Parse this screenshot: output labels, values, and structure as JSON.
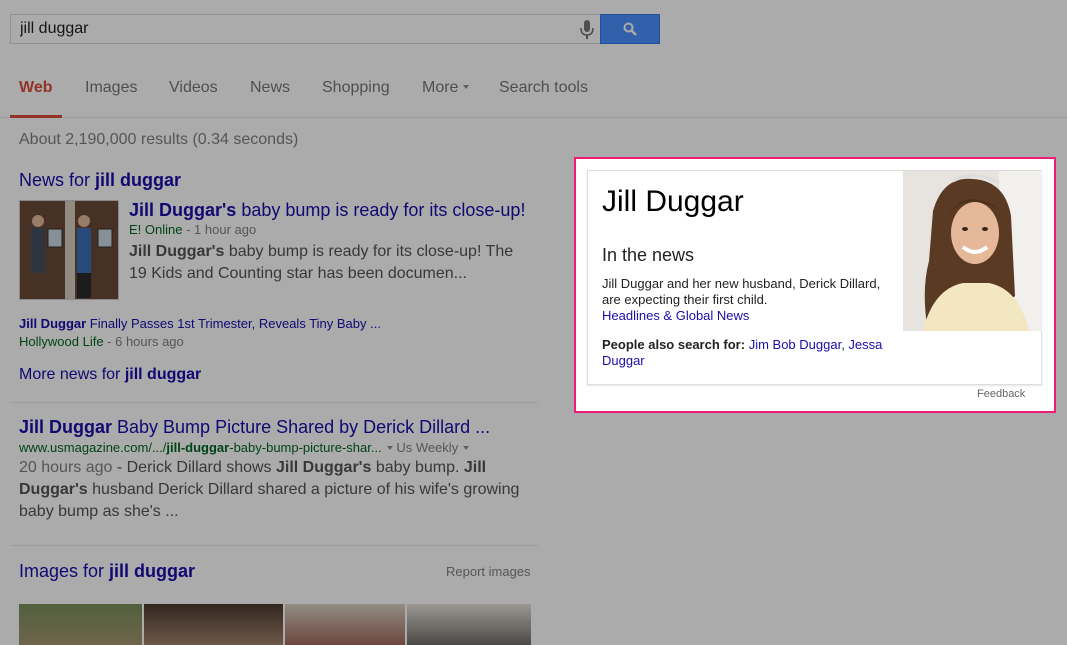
{
  "search": {
    "query": "jill duggar"
  },
  "tabs": [
    {
      "label": "Web",
      "active": true
    },
    {
      "label": "Images"
    },
    {
      "label": "Videos"
    },
    {
      "label": "News"
    },
    {
      "label": "Shopping"
    },
    {
      "label": "More"
    },
    {
      "label": "Search tools"
    }
  ],
  "stats": "About 2,190,000 results (0.34 seconds)",
  "news_block": {
    "header_prefix": "News for ",
    "header_query": "jill duggar",
    "top": {
      "title_bold": "Jill Duggar's",
      "title_rest": " baby bump is ready for its close-up!",
      "source": "E! Online",
      "time": " - 1 hour ago",
      "snippet_bold": "Jill Duggar's",
      "snippet_rest": " baby bump is ready for its close-up! The 19 Kids and Counting star has been documen..."
    },
    "second": {
      "title_bold": "Jill Duggar",
      "title_rest": " Finally Passes 1st Trimester, Reveals Tiny Baby ...",
      "source": "Hollywood Life",
      "time": " - 6 hours ago"
    },
    "more_prefix": "More news for ",
    "more_query": "jill duggar"
  },
  "result": {
    "title_bold": "Jill Duggar",
    "title_rest": " Baby Bump Picture Shared by Derick Dillard ...",
    "url_pre": "www.usmagazine.com/.../",
    "url_bold": "jill-duggar",
    "url_post": "-baby-bump-picture-shar...",
    "url_site": "Us Weekly",
    "snippet_date": "20 hours ago",
    "snippet_1": " - Derick Dillard shows ",
    "snippet_b1": "Jill Duggar's",
    "snippet_2": " baby bump. ",
    "snippet_b2": "Jill Duggar's",
    "snippet_3": " husband Derick Dillard shared a picture of his wife's growing baby bump as she's ..."
  },
  "images_block": {
    "header_prefix": "Images for ",
    "header_query": "jill duggar",
    "report": "Report images"
  },
  "knowledge_panel": {
    "title": "Jill Duggar",
    "subhead": "In the news",
    "text": "Jill Duggar and her new husband, Derick Dillard, are expecting their first child.",
    "headlines_link": "Headlines & Global News",
    "people_label": "People also search for:",
    "people": [
      "Jim Bob Duggar",
      "Jessa Duggar"
    ],
    "feedback": "Feedback"
  },
  "colors": {
    "accent_red": "#dd4b39",
    "link_blue": "#1a0dab",
    "url_green": "#006621",
    "highlight_pink": "#ec1c78"
  },
  "icons": [
    "mic-icon",
    "search-icon",
    "caret-down-icon"
  ]
}
